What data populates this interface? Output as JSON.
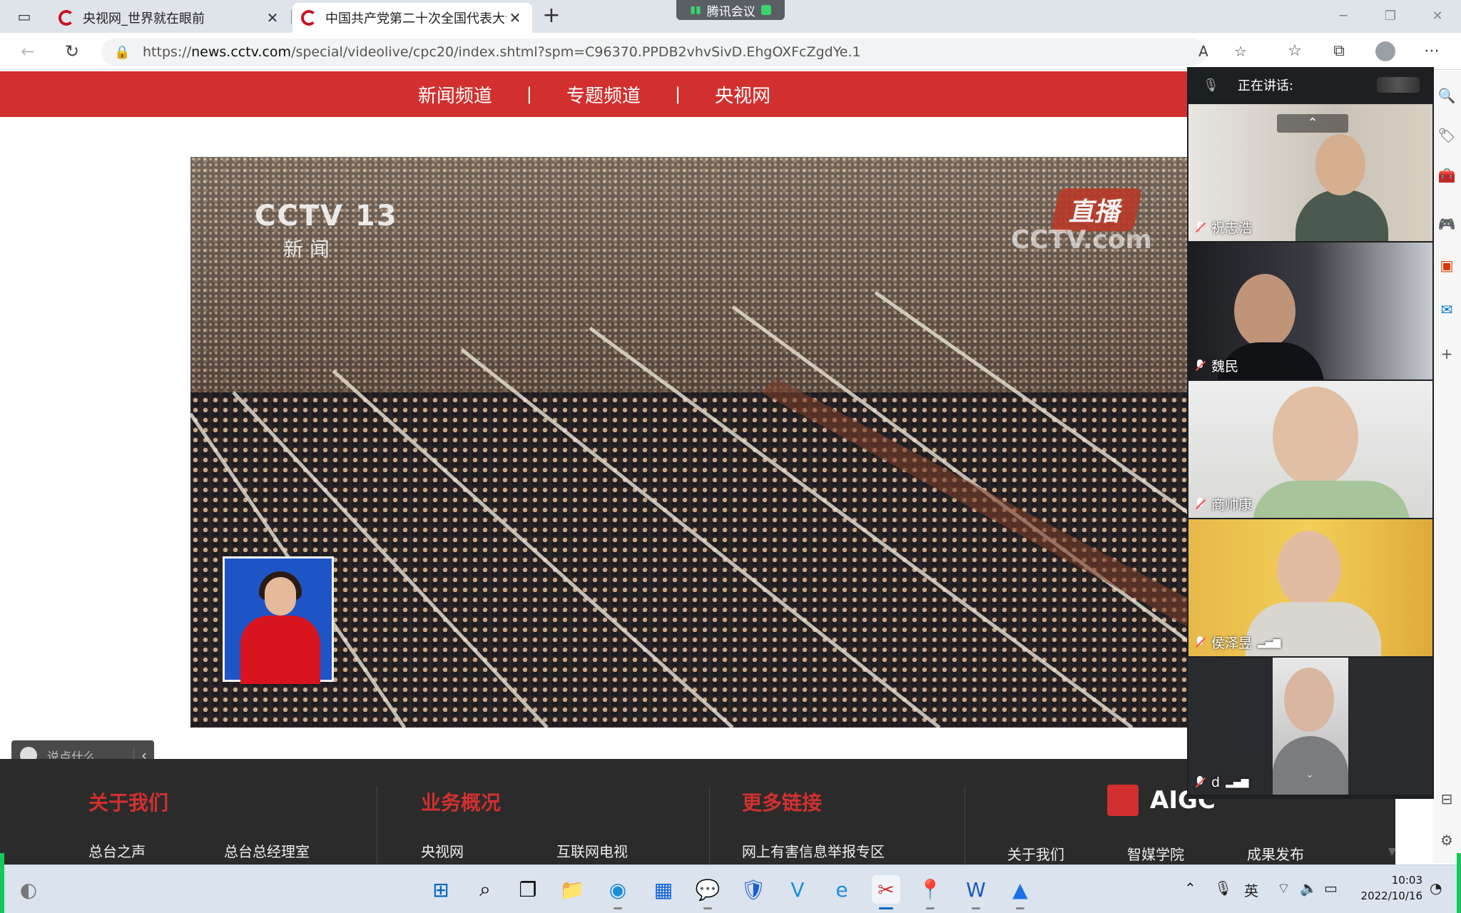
{
  "browser": {
    "tabs": [
      {
        "title": "央视网_世界就在眼前",
        "active": false
      },
      {
        "title": "中国共产党第二十次全国代表大会",
        "active": true
      }
    ],
    "url_prefix": "https://",
    "url_domain": "news.cctv.com",
    "url_path": "/special/videolive/cpc20/index.shtml?spm=C96370.PPDB2vhvSivD.EhgOXFcZgdYe.1"
  },
  "meeting": {
    "app_label": "腾讯会议",
    "speaking_label": "正在讲话:",
    "participants": [
      {
        "name": "祝志浩"
      },
      {
        "name": "魏民"
      },
      {
        "name": "商帅康"
      },
      {
        "name": "侯泽昱"
      },
      {
        "name": "d"
      }
    ]
  },
  "site": {
    "nav": [
      "新闻频道",
      "专题频道",
      "央视网"
    ],
    "nav_sep": "|"
  },
  "video": {
    "channel_logo": "CCTV 13",
    "channel_sub": "新 闻",
    "live_badge": "直播",
    "watermark": "CCTV.com"
  },
  "comment": {
    "placeholder": "说点什么..."
  },
  "footer": {
    "cols": [
      {
        "title": "关于我们",
        "links": [
          "总台之声",
          "总台总经理室"
        ]
      },
      {
        "title": "业务概况",
        "links": [
          "央视网",
          "互联网电视"
        ]
      },
      {
        "title": "更多链接",
        "links": [
          "网上有害信息举报专区"
        ]
      }
    ],
    "brand": "AIGC",
    "brand_links": [
      "关于我们",
      "智媒学院",
      "成果发布"
    ]
  },
  "taskbar": {
    "ime": "英",
    "time": "10:03",
    "date": "2022/10/16"
  },
  "colors": {
    "cctv_red": "#d1302f",
    "meeting_green": "#13c95a"
  }
}
